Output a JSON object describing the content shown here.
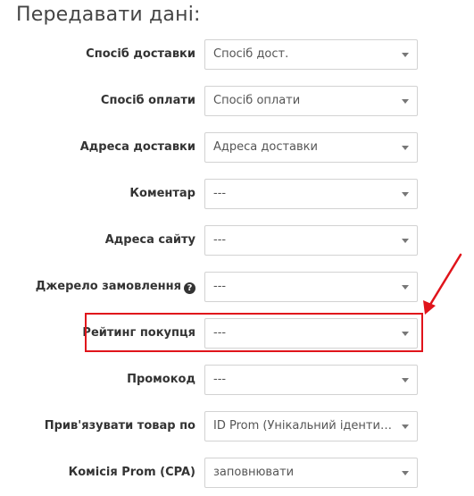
{
  "section": {
    "title": "Передавати дані:"
  },
  "rows": [
    {
      "label": "Спосіб доставки",
      "value": "Спосіб дост."
    },
    {
      "label": "Спосіб оплати",
      "value": "Спосіб оплати"
    },
    {
      "label": "Адреса доставки",
      "value": "Адреса доставки"
    },
    {
      "label": "Коментар",
      "value": "---"
    },
    {
      "label": "Адреса сайту",
      "value": "---"
    },
    {
      "label": "Джерело замовлення",
      "value": "---",
      "help_icon": "question-circle-icon"
    },
    {
      "label": "Рейтинг покупця",
      "value": "---"
    },
    {
      "label": "Промокод",
      "value": "---"
    },
    {
      "label": "Прив'язувати товар по",
      "value": "ID Prom (Унікальний ідентифікатор)"
    },
    {
      "label": "Комісія Prom (CPA)",
      "value": "заповнювати"
    }
  ],
  "annotation": {
    "highlight_color": "#e0141b",
    "arrow_color": "#e0141b",
    "highlighted_row": "Рейтинг покупця"
  }
}
